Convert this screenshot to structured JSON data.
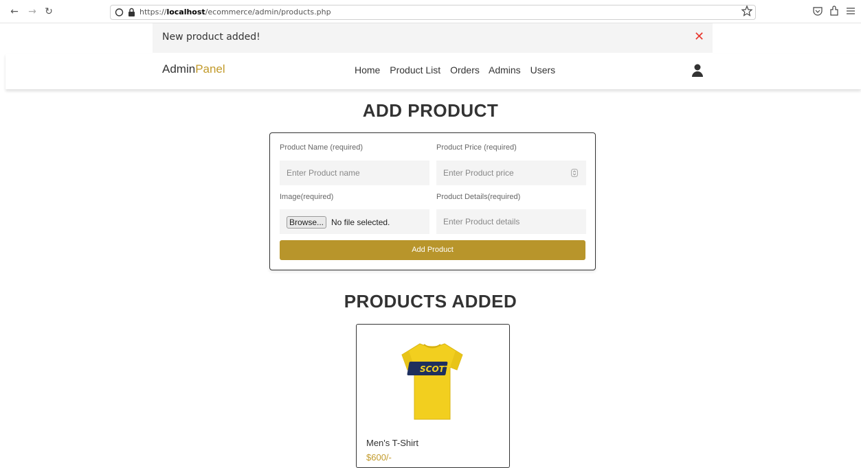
{
  "browser": {
    "url_prefix": "https://",
    "url_host": "localhost",
    "url_path": "/ecommerce/admin/products.php",
    "back_icon": "arrow-left",
    "forward_icon": "arrow-right",
    "reload_icon": "reload",
    "menu_icon": "hamburger"
  },
  "flash": {
    "message": "New product added!",
    "close_symbol": "✕",
    "close_color": "#e8382f"
  },
  "header": {
    "logo_main": "Admin",
    "logo_accent": "Panel",
    "accent_color": "#c29a2a",
    "nav": [
      "Home",
      "Product List",
      "Orders",
      "Admins",
      "Users"
    ]
  },
  "add_product": {
    "title": "ADD PRODUCT",
    "name_label": "Product Name (required)",
    "name_placeholder": "Enter Product name",
    "price_label": "Product Price (required)",
    "price_placeholder": "Enter Product price",
    "image_label": "Image(required)",
    "browse_label": "Browse...",
    "no_file_text": "No file selected.",
    "details_label": "Product Details(required)",
    "details_placeholder": "Enter Product details",
    "submit_label": "Add Product",
    "submit_color": "#b8952b"
  },
  "products_added": {
    "title": "PRODUCTS ADDED",
    "items": [
      {
        "name": "Men's T-Shirt",
        "price": "$600/-",
        "image_icon": "yellow-tshirt"
      }
    ]
  }
}
